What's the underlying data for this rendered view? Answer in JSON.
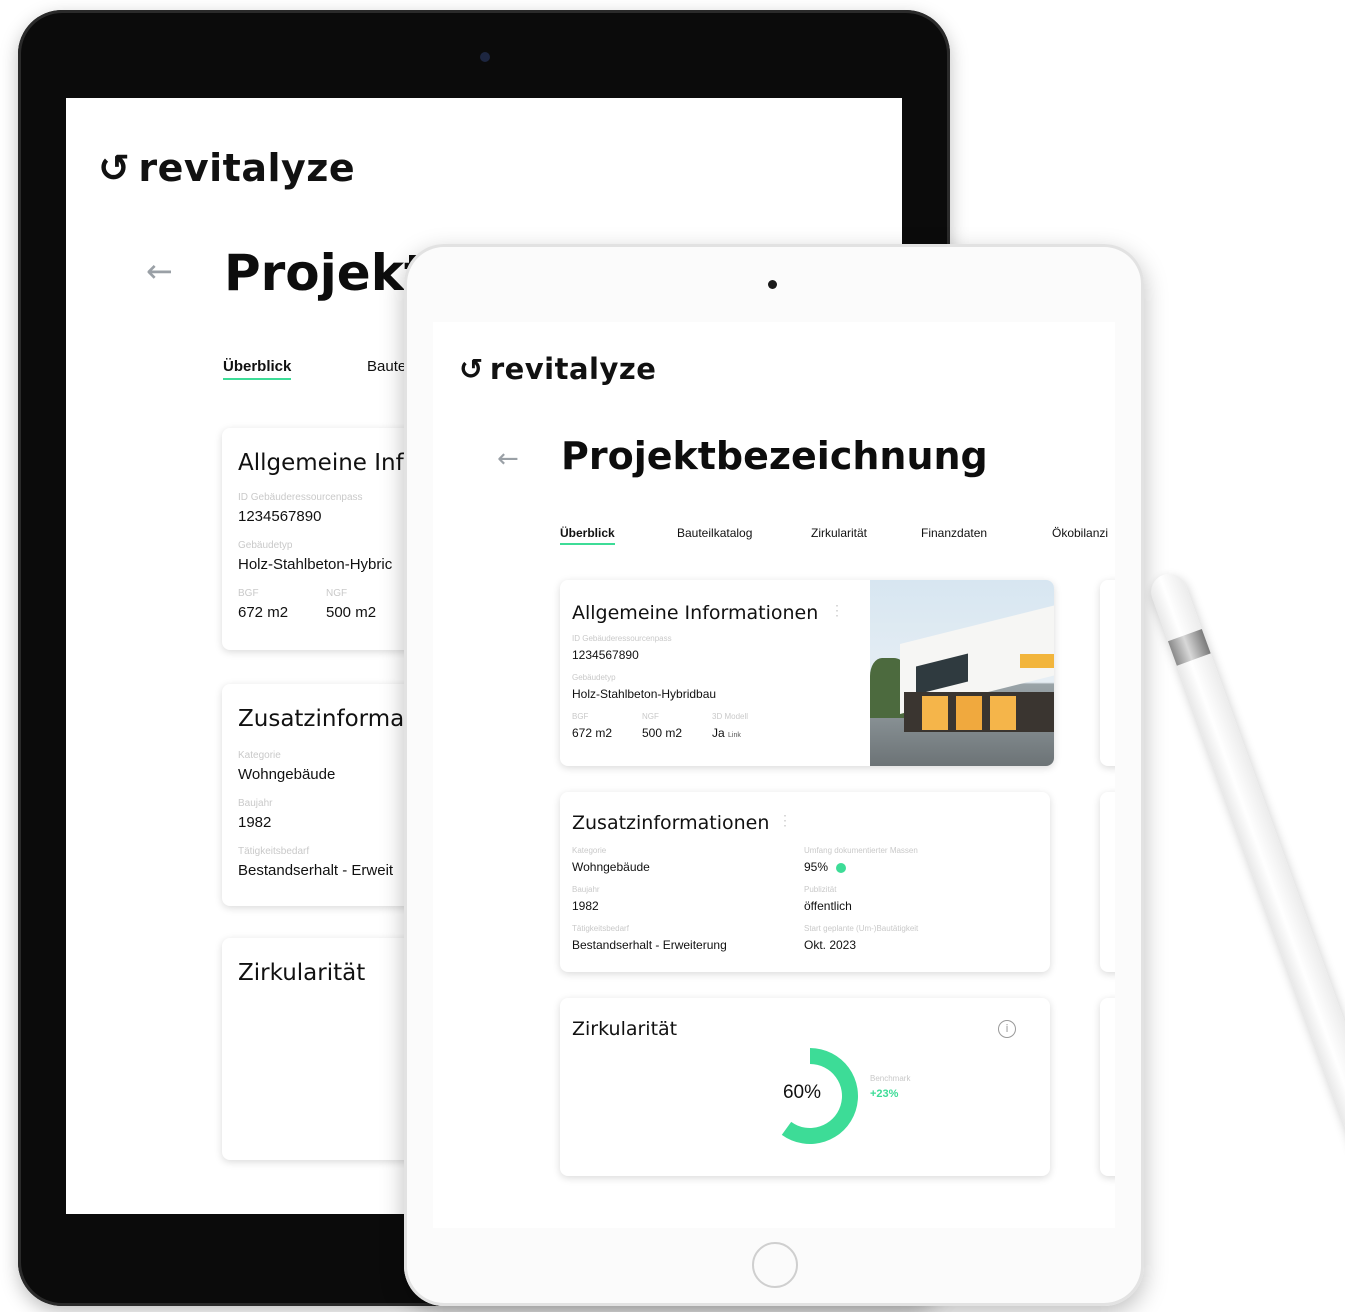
{
  "brand": {
    "name": "revitalyze",
    "mark": "↺"
  },
  "page": {
    "back": "←",
    "title": "Projektbezeichnung"
  },
  "tabs": [
    "Überblick",
    "Bauteilkatalog",
    "Zirkularität",
    "Finanzdaten",
    "Ökobilanzi"
  ],
  "back_device": {
    "title_visible": "Projektb",
    "tabs_visible": [
      "Überblick",
      "Baute"
    ],
    "card1_title": "Allgemeine Inf",
    "card2_title": "Zusatzinforma",
    "card3_title": "Zirkularität",
    "g_typ_val": "Holz-Stahlbeton-Hybric",
    "erhalt_val": "Bestandserhalt - Erweit"
  },
  "general": {
    "title": "Allgemeine Informationen",
    "id_label": "ID Gebäuderessourcenpass",
    "id_value": "1234567890",
    "typ_label": "Gebäudetyp",
    "typ_value": "Holz-Stahlbeton-Hybridbau",
    "bgf_label": "BGF",
    "bgf_value": "672 m2",
    "ngf_label": "NGF",
    "ngf_value": "500 m2",
    "model_label": "3D Modell",
    "model_value": "Ja",
    "model_link": "Link"
  },
  "extra": {
    "title": "Zusatzinformationen",
    "kategorie_label": "Kategorie",
    "kategorie_value": "Wohngebäude",
    "baujahr_label": "Baujahr",
    "baujahr_value": "1982",
    "bedarf_label": "Tätigkeitsbedarf",
    "bedarf_value": "Bestandserhalt - Erweiterung",
    "umfang_label": "Umfang dokumentierter Massen",
    "umfang_value": "95%",
    "publizitaet_label": "Publizität",
    "publizitaet_value": "öffentlich",
    "start_label": "Start geplante (Um-)Bautätigkeit",
    "start_value": "Okt. 2023"
  },
  "circularity": {
    "title": "Zirkularität",
    "value_label": "60%",
    "value": 0.6,
    "benchmark_label": "Benchmark",
    "benchmark_value": "+23%"
  },
  "colors": {
    "accent": "#3ddc97",
    "text": "#111111",
    "label": "#c9c9c9"
  }
}
